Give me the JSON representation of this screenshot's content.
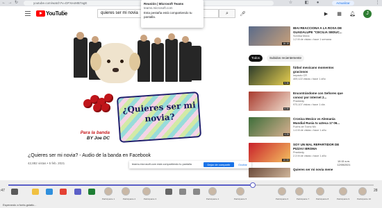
{
  "browser": {
    "url": "youtube.com/watch?v=DFXeoMB7agE",
    "update_label": "Actualizar",
    "avatar_letter": "J"
  },
  "teams_popup": {
    "line1": "Reunión | Microsoft Teams",
    "line2": "teams.microsoft.com",
    "line3": "Esta pestaña está compartiendo tu pantalla."
  },
  "youtube": {
    "logo_word": "YouTube",
    "logo_country": "CO",
    "search_value": "quieres ser mi novia",
    "avatar_letter": "J"
  },
  "video": {
    "sign_text": "¿Quieres ser mi novia?",
    "caption_line1": "Para la banda",
    "caption_line2": "BY Joe DC",
    "title": "¿Quieres ser mi novia? - Audio de la banda en Facebook",
    "meta": "42,882 vistas • 5 feb. 2021"
  },
  "share_bar": {
    "message": "teams.microsoft.com está compartiendo tu pantalla",
    "stop_label": "Dejar de compartir",
    "hide_label": "Ocultar"
  },
  "sidebar": {
    "chips": [
      "Todos",
      "Subidos recientemente"
    ],
    "recommendations": [
      {
        "title": "IBAI REACCIONA A LA ROSA DE GUADALUPE \"CECILIA SEDUC...",
        "channel": "Sonrisa Mona",
        "views": "1.2 M de vistas • hace 1 semana",
        "duration": "16:15"
      },
      {
        "title": "fútbol mexicano momentos graciosos",
        "channel": "Impacto CR",
        "views": "409,122 vistas • hace 1 año",
        "duration": "9:36"
      },
      {
        "title": "Encontrándome con Señores que conocí por internet 2...",
        "channel": "Prankedy",
        "views": "970,107 vistas • hace 1 día",
        "duration": "6:30"
      },
      {
        "title": "Cronica Mexico vs Alemania Mundial Rusia tv azteca 17 06...",
        "channel": "Fuchs de Tocho Mx",
        "views": "1.4 M de vistas • hace 1 año",
        "duration": "4:28"
      },
      {
        "title": "SOY UN MAL REPARTIDOR DE PIZZA!! BROMA",
        "channel": "Prankedy",
        "views": "2.3 M de vistas • hace 1 año",
        "duration": "10:33"
      },
      {
        "title": "Quieres ser mi novia mene",
        "channel": "",
        "views": "",
        "duration": ""
      }
    ]
  },
  "tray": {
    "time": "10:15 a.m.",
    "date": "12/05/2021"
  },
  "teams_bar": {
    "time_left": ":47",
    "time_right": "28",
    "participants": [
      "Participante 1",
      "Participante 2",
      "Participante 3",
      "Participante 4",
      "Participante 5",
      "Participante 6",
      "Participante 7",
      "Participante 8",
      "Participante 9",
      "Participante 10"
    ],
    "progress": 0.67
  },
  "status": {
    "text": "Esperando a fonts.gstatic..."
  }
}
